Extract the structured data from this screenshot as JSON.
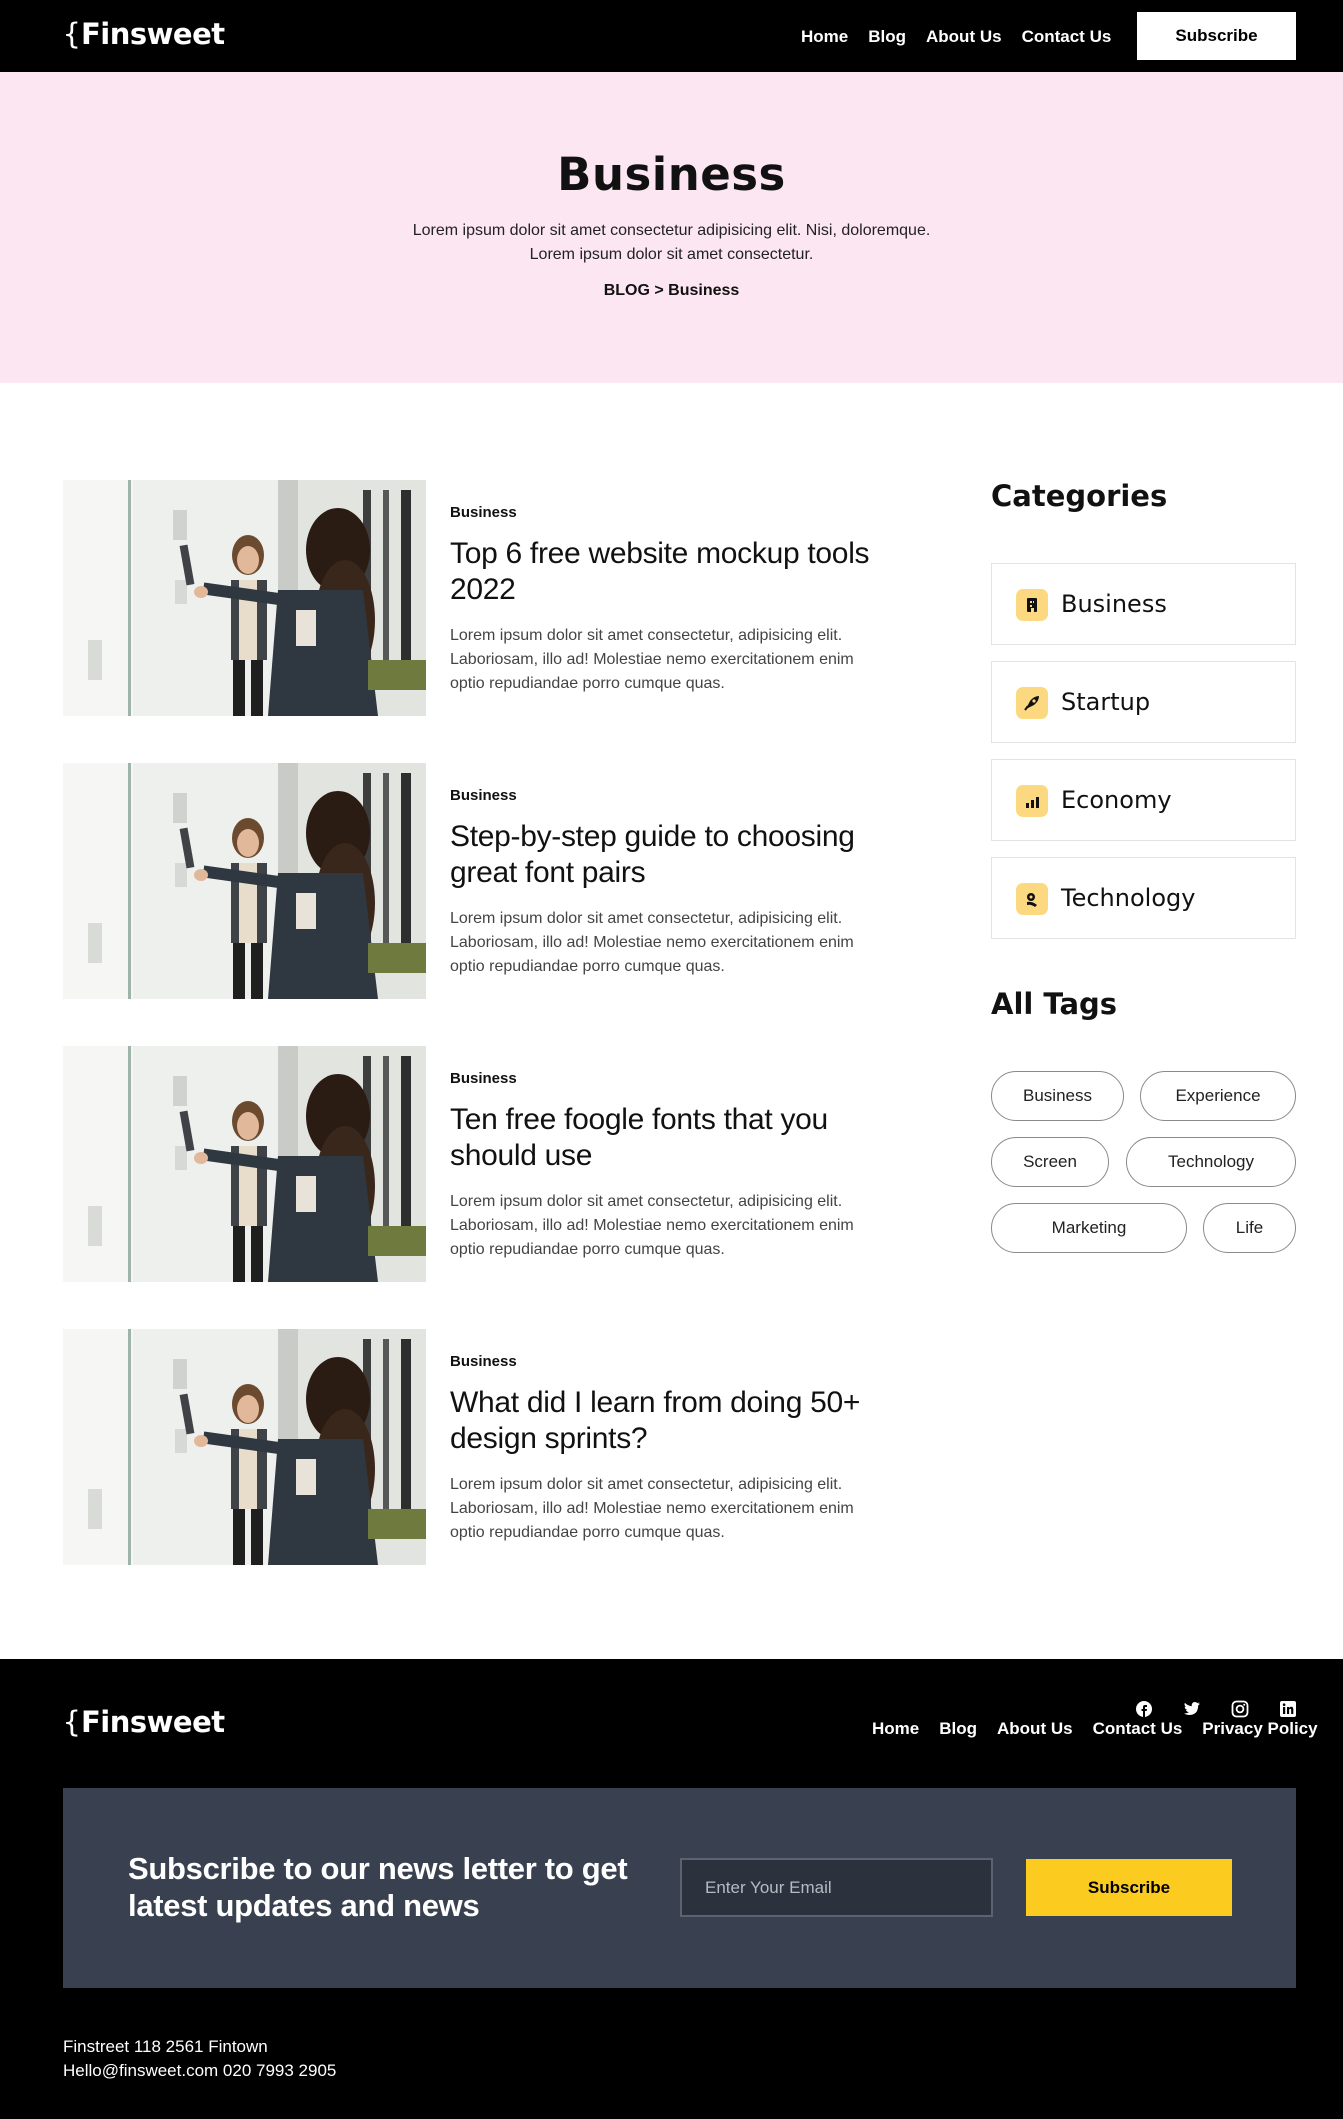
{
  "header": {
    "logo_brace": "{",
    "logo_text": "Finsweet",
    "nav": [
      "Home",
      "Blog",
      "About Us",
      "Contact Us"
    ],
    "subscribe_label": "Subscribe"
  },
  "hero": {
    "title": "Business",
    "desc_line1": "Lorem ipsum dolor sit amet consectetur adipisicing elit. Nisi, doloremque.",
    "desc_line2": "Lorem ipsum dolor sit amet consectetur.",
    "breadcrumb": "BLOG > Business"
  },
  "posts": [
    {
      "category": "Business",
      "title": "Top 6 free website mockup tools 2022",
      "excerpt": "Lorem ipsum dolor sit amet consectetur, adipisicing elit. Laboriosam, illo ad! Molestiae nemo exercitationem enim optio repudiandae porro cumque quas."
    },
    {
      "category": "Business",
      "title": "Step-by-step guide to choosing great font pairs",
      "excerpt": "Lorem ipsum dolor sit amet consectetur, adipisicing elit. Laboriosam, illo ad! Molestiae nemo exercitationem enim optio repudiandae porro cumque quas."
    },
    {
      "category": "Business",
      "title": "Ten free foogle fonts that you should use",
      "excerpt": "Lorem ipsum dolor sit amet consectetur, adipisicing elit. Laboriosam, illo ad! Molestiae nemo exercitationem enim optio repudiandae porro cumque quas."
    },
    {
      "category": "Business",
      "title": "What did I learn from doing 50+ design sprints?",
      "excerpt": "Lorem ipsum dolor sit amet consectetur, adipisicing elit. Laboriosam, illo ad! Molestiae nemo exercitationem enim optio repudiandae porro cumque quas."
    }
  ],
  "sidebar": {
    "categories_heading": "Categories",
    "categories": [
      {
        "label": "Business",
        "icon": "building-icon"
      },
      {
        "label": "Startup",
        "icon": "rocket-icon"
      },
      {
        "label": "Economy",
        "icon": "bar-chart-icon"
      },
      {
        "label": "Technology",
        "icon": "gear-hand-icon"
      }
    ],
    "tags_heading": "All Tags",
    "tags": [
      "Business",
      "Experience",
      "Screen",
      "Technology",
      "Marketing",
      "Life"
    ]
  },
  "footer": {
    "logo_brace": "{",
    "logo_text": "Finsweet",
    "nav": [
      "Home",
      "Blog",
      "About Us",
      "Contact Us",
      "Privacy Policy"
    ],
    "newsletter_title": "Subscribe to our news letter to get latest updates and news",
    "email_placeholder": "Enter Your Email",
    "subscribe_label": "Subscribe",
    "address": "Finstreet 118 2561 Fintown",
    "contact": "Hello@finsweet.com 020 7993 2905",
    "social_icons": [
      "facebook-icon",
      "twitter-icon",
      "instagram-icon",
      "linkedin-icon"
    ]
  },
  "colors": {
    "hero_bg": "#fce6f1",
    "newsletter_bg": "#394150",
    "accent_yellow": "#fbcc1f",
    "icon_bg": "#fcd980"
  }
}
